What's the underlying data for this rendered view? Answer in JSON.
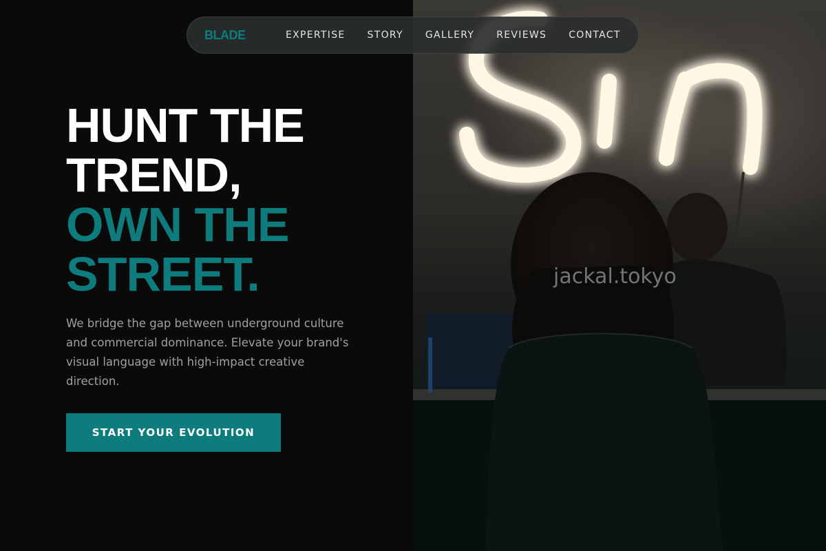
{
  "nav": {
    "brand": "BLADE",
    "links": [
      "EXPERTISE",
      "STORY",
      "GALLERY",
      "REVIEWS",
      "CONTACT"
    ]
  },
  "hero": {
    "title_lines": [
      "HUNT THE",
      "TREND,"
    ],
    "accent_lines": [
      "OWN THE",
      "STREET."
    ],
    "description": "We bridge the gap between underground culture and commercial dominance. Elevate your brand's visual language with high-impact creative direction.",
    "cta_label": "START YOUR EVOLUTION"
  },
  "image": {
    "neon_sign_text": "Sin",
    "watermark": "jackal.tokyo"
  },
  "colors": {
    "background": "#0a0a0a",
    "accent": "#0e7c7c",
    "text_primary": "#ffffff",
    "text_muted": "#a0a0a0",
    "nav_background": "#2a2e2e"
  }
}
